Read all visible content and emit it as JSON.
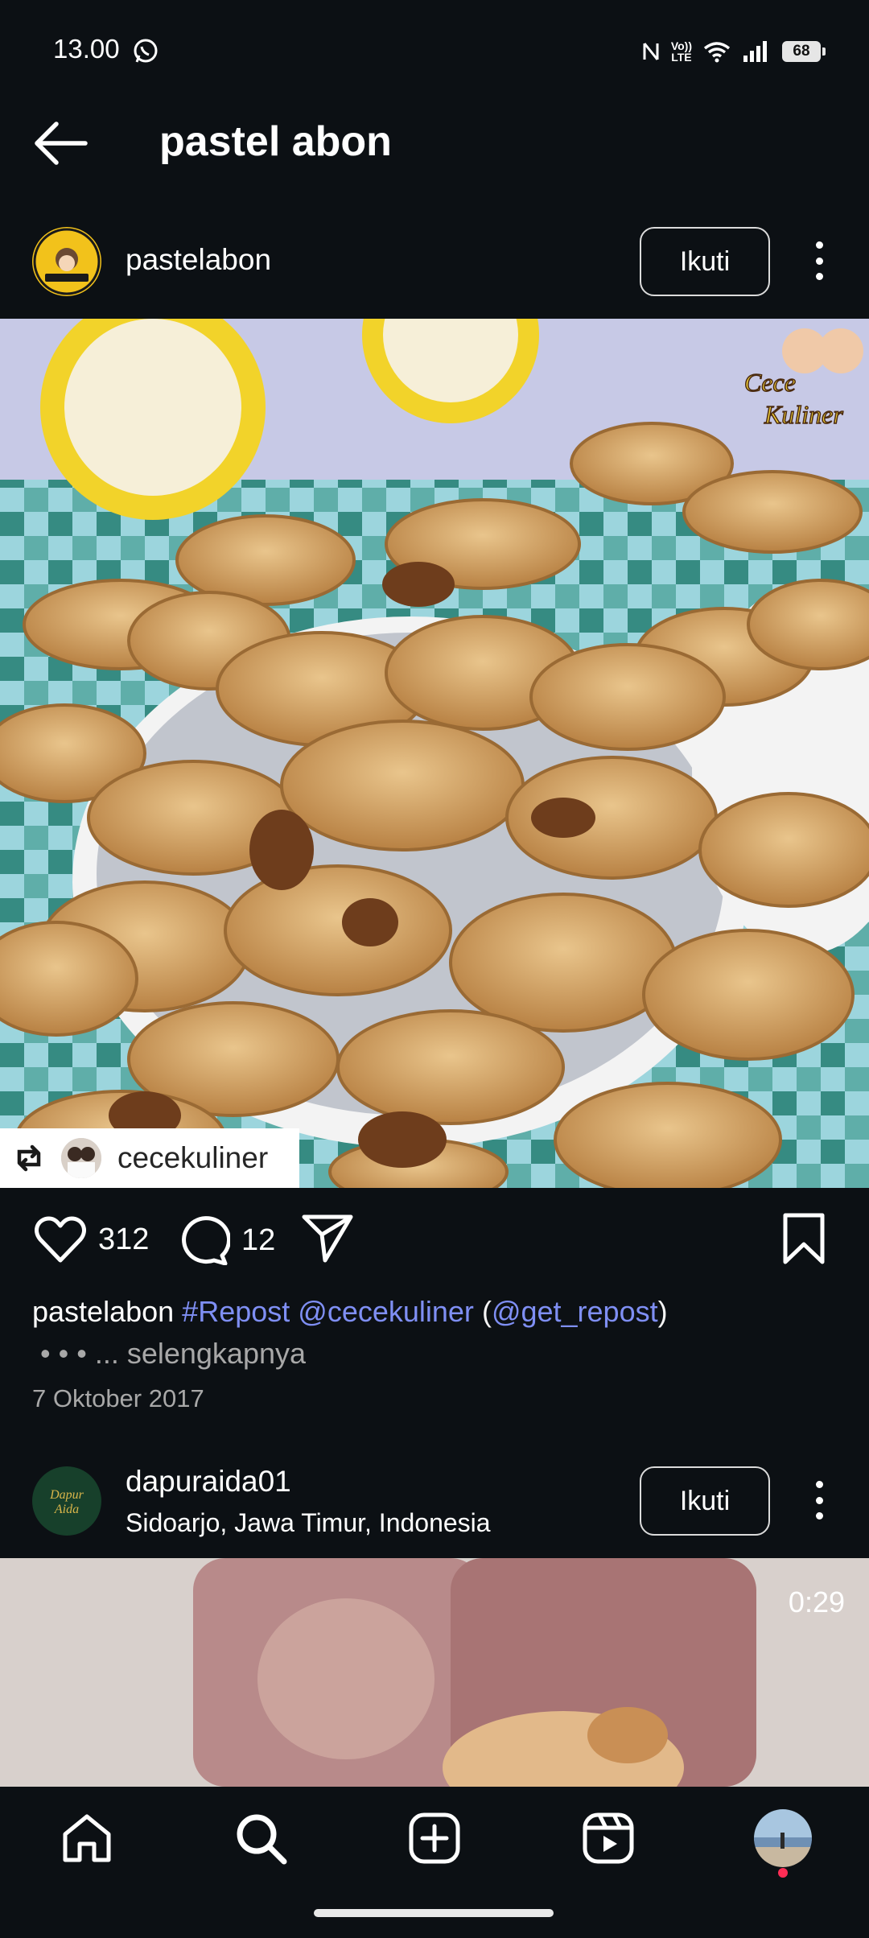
{
  "status_bar": {
    "time": "13.00",
    "battery": "68",
    "lte_label": "Vo)) LTE"
  },
  "header": {
    "title": "pastel abon"
  },
  "post1": {
    "username": "pastelabon",
    "follow_label": "Ikuti",
    "repost_from": "cecekuliner",
    "likes": "312",
    "comments": "12",
    "caption": {
      "username": "pastelabon",
      "hashtag": "#Repost",
      "mention": "@cecekuliner",
      "paren_open": "(",
      "mention2": "@get_repost",
      "paren_close": ")",
      "dots": "•  •  •",
      "more": "... selengkapnya"
    },
    "date": "7 Oktober 2017"
  },
  "post2": {
    "username": "dapuraida01",
    "location": "Sidoarjo, Jawa Timur, Indonesia",
    "follow_label": "Ikuti",
    "duration": "0:29"
  },
  "icons": {
    "back": "arrow-left-icon",
    "like": "heart-icon",
    "comment": "speech-bubble-icon",
    "share": "paper-plane-icon",
    "save": "bookmark-icon",
    "home": "home-icon",
    "search": "search-icon",
    "create": "plus-square-icon",
    "reels": "reels-icon"
  }
}
